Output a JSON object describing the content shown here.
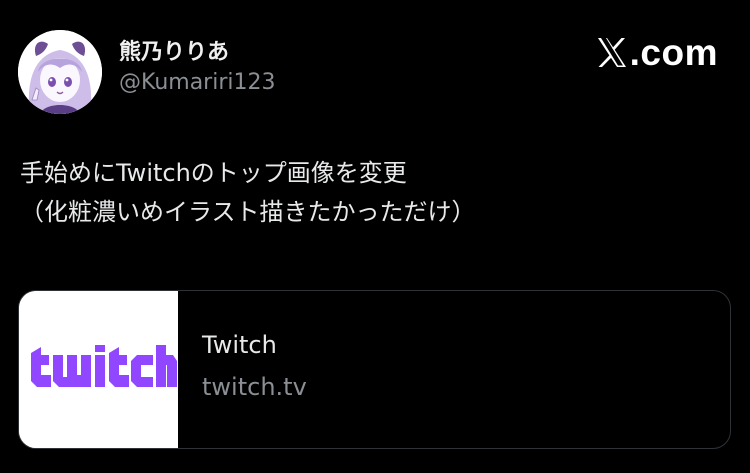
{
  "author": {
    "display_name": "熊乃りりあ",
    "handle": "@Kumariri123",
    "avatar_icon": "anime-girl-avatar"
  },
  "brand": {
    "logo_icon": "x-logo-icon",
    "text": ".com"
  },
  "tweet": {
    "lines": [
      "手始めにTwitchのトップ画像を変更",
      "（化粧濃いめイラスト描きたかっただけ）"
    ]
  },
  "link_card": {
    "title": "Twitch",
    "domain": "twitch.tv",
    "thumbnail_icon": "twitch-logo"
  },
  "colors": {
    "background": "#000000",
    "text": "#e7e9ea",
    "secondary_text": "#8b8f94",
    "card_border": "#2f3336",
    "twitch_purple": "#9146ff"
  }
}
